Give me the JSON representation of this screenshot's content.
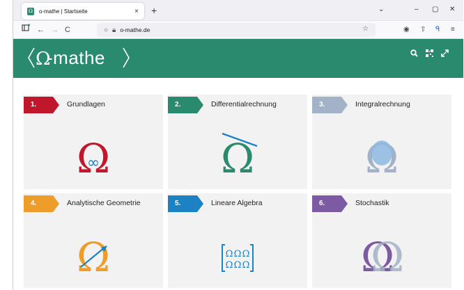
{
  "browser": {
    "tab_title": "o-mathe | Startseite",
    "tab_close": "×",
    "new_tab": "+",
    "url": "o-mathe.de",
    "controls": {
      "minimize": "–",
      "maximize": "▢",
      "close": "✕",
      "list_all": "⌄"
    }
  },
  "site": {
    "logo_text": "-mathe",
    "brand_color": "#2a8a6d"
  },
  "cards": [
    {
      "num": "1.",
      "title": "Grundlagen",
      "color": "#c0172d",
      "icon": "omega-infinity-icon"
    },
    {
      "num": "2.",
      "title": "Differentialrechnung",
      "color": "#2a8a6d",
      "icon": "omega-tangent-icon"
    },
    {
      "num": "3.",
      "title": "Integralrechnung",
      "color": "#a3b2c6",
      "icon": "omega-integral-icon"
    },
    {
      "num": "4.",
      "title": "Analytische Geometrie",
      "color": "#ee9c2a",
      "icon": "omega-vector-icon"
    },
    {
      "num": "5.",
      "title": "Lineare Algebra",
      "color": "#1d82c4",
      "icon": "omega-matrix-icon"
    },
    {
      "num": "6.",
      "title": "Stochastik",
      "color": "#7c5ba3",
      "icon": "omega-overlap-icon"
    }
  ],
  "matrix_cell": "Ω"
}
